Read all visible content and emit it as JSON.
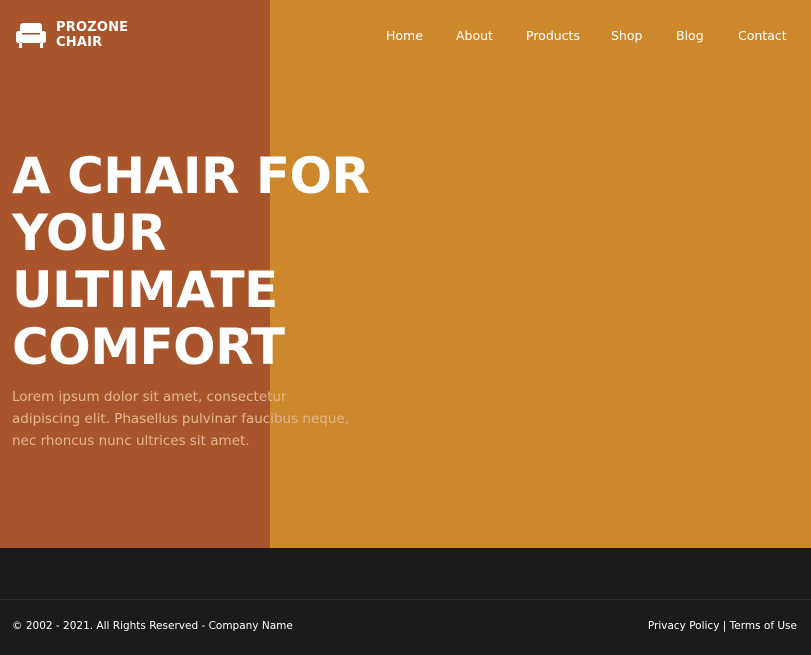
{
  "colors": {
    "hero_background": "#cc882b",
    "hero_left_panel": "#a9552c",
    "footer_background": "#1b1b1b",
    "text_primary": "#ffffff",
    "text_muted": "#e3b68f"
  },
  "brand": {
    "icon": "armchair-icon",
    "line1": "PROZONE",
    "line2": "CHAIR"
  },
  "nav": {
    "items": [
      {
        "label": "Home"
      },
      {
        "label": "About"
      },
      {
        "label": "Products"
      },
      {
        "label": "Shop"
      },
      {
        "label": "Blog"
      },
      {
        "label": "Contact"
      }
    ]
  },
  "hero": {
    "title_lines": [
      "A CHAIR FOR",
      "YOUR",
      "ULTIMATE",
      "COMFORT"
    ],
    "description": "Lorem ipsum dolor sit amet, consectetur adipiscing elit. Phasellus pulvinar faucibus neque, nec rhoncus nunc ultrices sit amet."
  },
  "footer": {
    "copyright": "© 2002 - 2021. All Rights Reserved - Company Name",
    "privacy_label": "Privacy Policy",
    "separator": "|",
    "terms_label": "Terms of Use"
  }
}
